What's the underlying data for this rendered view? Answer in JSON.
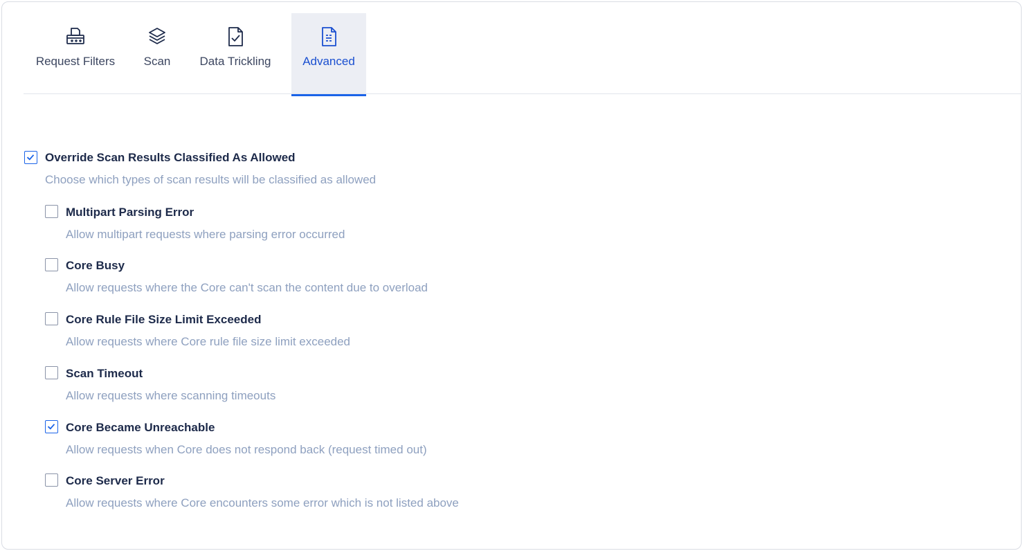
{
  "tabs": [
    {
      "label": "Request Filters",
      "icon": "filter-device-icon",
      "active": false
    },
    {
      "label": "Scan",
      "icon": "layers-icon",
      "active": false
    },
    {
      "label": "Data Trickling",
      "icon": "document-check-icon",
      "active": false
    },
    {
      "label": "Advanced",
      "icon": "document-text-icon",
      "active": true
    }
  ],
  "override": {
    "title": "Override Scan Results Classified As Allowed",
    "description": "Choose which types of scan results will be classified as allowed",
    "checked": true
  },
  "options": [
    {
      "title": "Multipart Parsing Error",
      "description": "Allow multipart requests where parsing error occurred",
      "checked": false
    },
    {
      "title": "Core Busy",
      "description": "Allow requests where the Core can't scan the content due to overload",
      "checked": false
    },
    {
      "title": "Core Rule File Size Limit Exceeded",
      "description": "Allow requests where Core rule file size limit exceeded",
      "checked": false
    },
    {
      "title": "Scan Timeout",
      "description": "Allow requests where scanning timeouts",
      "checked": false
    },
    {
      "title": "Core Became Unreachable",
      "description": "Allow requests when Core does not respond back (request timed out)",
      "checked": true
    },
    {
      "title": "Core Server Error",
      "description": "Allow requests where Core encounters some error which is not listed above",
      "checked": false
    }
  ],
  "colors": {
    "accent": "#1a63e8",
    "active_tab_bg": "#eceef4",
    "description_text": "#8ea0bf"
  }
}
